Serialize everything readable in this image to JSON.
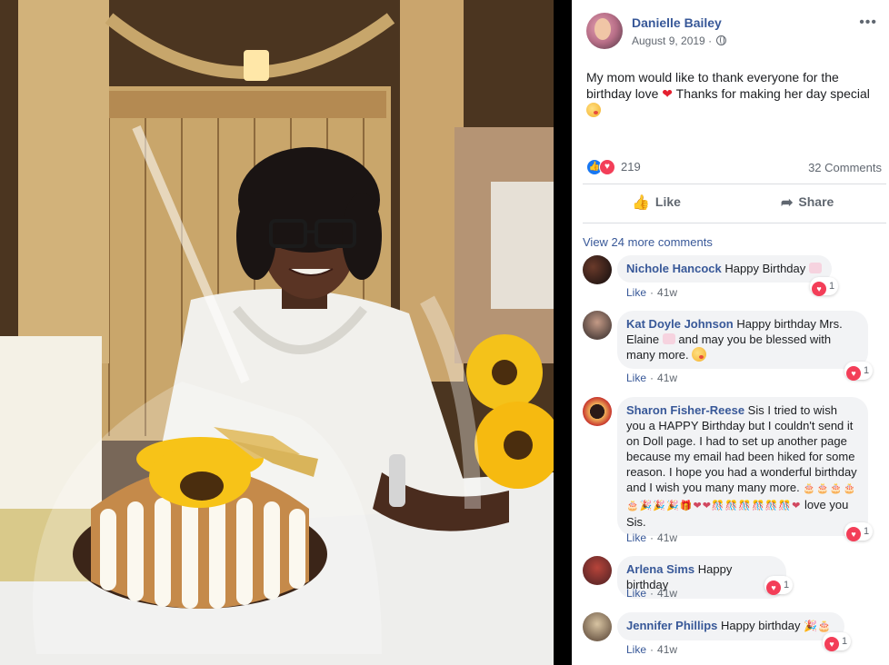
{
  "post": {
    "author": "Danielle Bailey",
    "date": "August 9, 2019 ·",
    "text": "My mom would like to thank everyone for the birthday love",
    "text_cont": "Thanks for making her day special",
    "reaction_count": "219",
    "comments_count": "32 Comments"
  },
  "actions": {
    "like": "Like",
    "share": "Share"
  },
  "view_more": "View 24 more comments",
  "icons": {
    "more": "more-options-icon",
    "globe": "globe-icon",
    "like": "thumbs-up-icon",
    "love": "heart-icon",
    "share": "share-arrow-icon"
  },
  "comments": [
    {
      "name": "Nichole Hancock",
      "text": "Happy Birthday",
      "like": "Like",
      "time": "41w",
      "reactions": "1"
    },
    {
      "name": "Kat Doyle Johnson",
      "text": "Happy birthday Mrs. Elaine",
      "text2": "and may you be blessed with many more.",
      "like": "Like",
      "time": "41w",
      "reactions": "1"
    },
    {
      "name": "Sharon Fisher-Reese",
      "text": "Sis I tried to wish you a HAPPY Birthday but I couldn't send it on Doll page. I had to set up another page because my email had been hiked for some reason. I hope you had a wonderful birthday and I wish you many many more.",
      "text2": "love you Sis.",
      "like": "Like",
      "time": "41w",
      "reactions": "1"
    },
    {
      "name": "Arlena Sims",
      "text": "Happy birthday",
      "like": "Like",
      "time": "41w",
      "reactions": "1"
    },
    {
      "name": "Jennifer Phillips",
      "text": "Happy birthday",
      "like": "Like",
      "time": "41w",
      "reactions": "1"
    }
  ],
  "colors": {
    "link": "#385898",
    "meta": "#606770",
    "bubble": "#f2f3f5",
    "like_blue": "#1877f2",
    "love_red": "#f33e58"
  }
}
